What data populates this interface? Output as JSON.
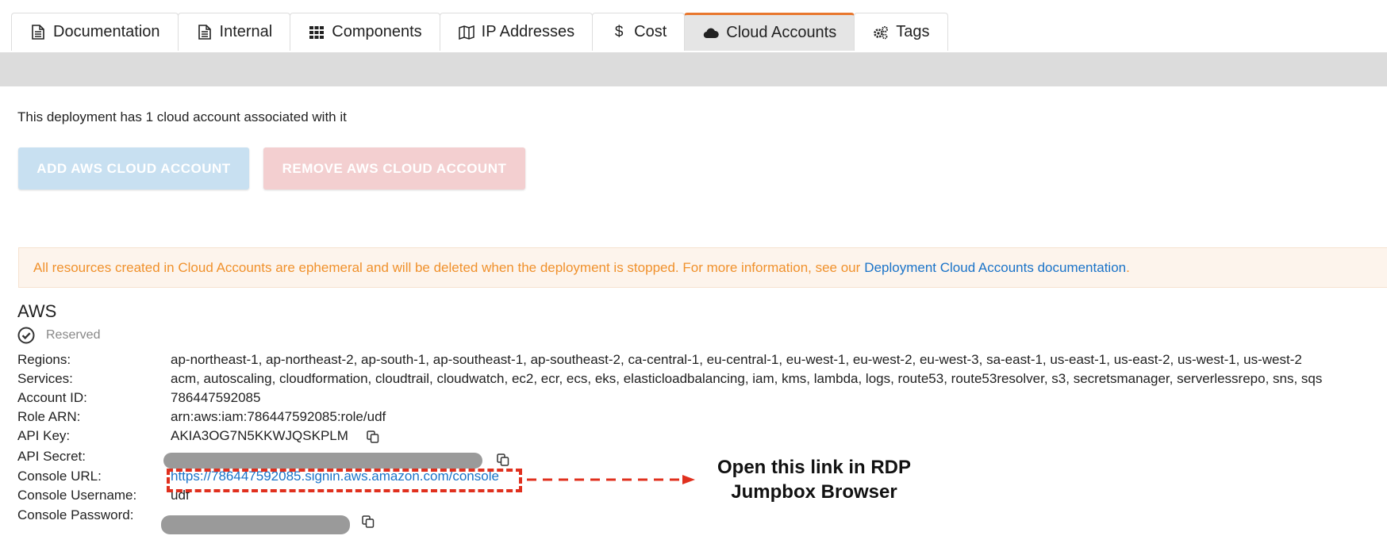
{
  "tabs": [
    {
      "label": "Documentation",
      "icon": "document-icon"
    },
    {
      "label": "Internal",
      "icon": "document-icon"
    },
    {
      "label": "Components",
      "icon": "grid-icon"
    },
    {
      "label": "IP Addresses",
      "icon": "map-icon"
    },
    {
      "label": "Cost",
      "icon": "dollar-icon"
    },
    {
      "label": "Cloud Accounts",
      "icon": "cloud-icon",
      "active": true
    },
    {
      "label": "Tags",
      "icon": "gears-icon"
    }
  ],
  "summary": "This deployment has 1 cloud account associated with it",
  "buttons": {
    "add": "ADD AWS CLOUD ACCOUNT",
    "remove": "REMOVE AWS CLOUD ACCOUNT"
  },
  "alert": {
    "text": "All resources created in Cloud Accounts are ephemeral and will be deleted when the deployment is stopped. For more information, see our",
    "link": "Deployment Cloud Accounts documentation",
    "suffix": "."
  },
  "account": {
    "provider": "AWS",
    "status": "Reserved",
    "fields": {
      "regions": {
        "label": "Regions:",
        "value": "ap-northeast-1, ap-northeast-2, ap-south-1, ap-southeast-1, ap-southeast-2, ca-central-1, eu-central-1, eu-west-1, eu-west-2, eu-west-3, sa-east-1, us-east-1, us-east-2, us-west-1, us-west-2"
      },
      "services": {
        "label": "Services:",
        "value": "acm, autoscaling, cloudformation, cloudtrail, cloudwatch, ec2, ecr, ecs, eks, elasticloadbalancing, iam, kms, lambda, logs, route53, route53resolver, s3, secretsmanager, serverlessrepo, sns, sqs"
      },
      "account_id": {
        "label": "Account ID:",
        "value": "786447592085"
      },
      "role_arn": {
        "label": "Role ARN:",
        "value": "arn:aws:iam:786447592085:role/udf"
      },
      "api_key": {
        "label": "API Key:",
        "value": "AKIA3OG7N5KKWJQSKPLM"
      },
      "api_secret": {
        "label": "API Secret:"
      },
      "console_url": {
        "label": "Console URL:",
        "value": "https://786447592085.signin.aws.amazon.com/console"
      },
      "console_username": {
        "label": "Console Username:",
        "value": "udf"
      },
      "console_password": {
        "label": "Console Password:"
      }
    }
  },
  "annotation": {
    "line1": "Open this link in RDP",
    "line2": "Jumpbox Browser"
  },
  "colors": {
    "accent": "#e8772e",
    "link": "#1a73c8",
    "alert_text": "#f0912c",
    "highlight": "#e0301e"
  }
}
